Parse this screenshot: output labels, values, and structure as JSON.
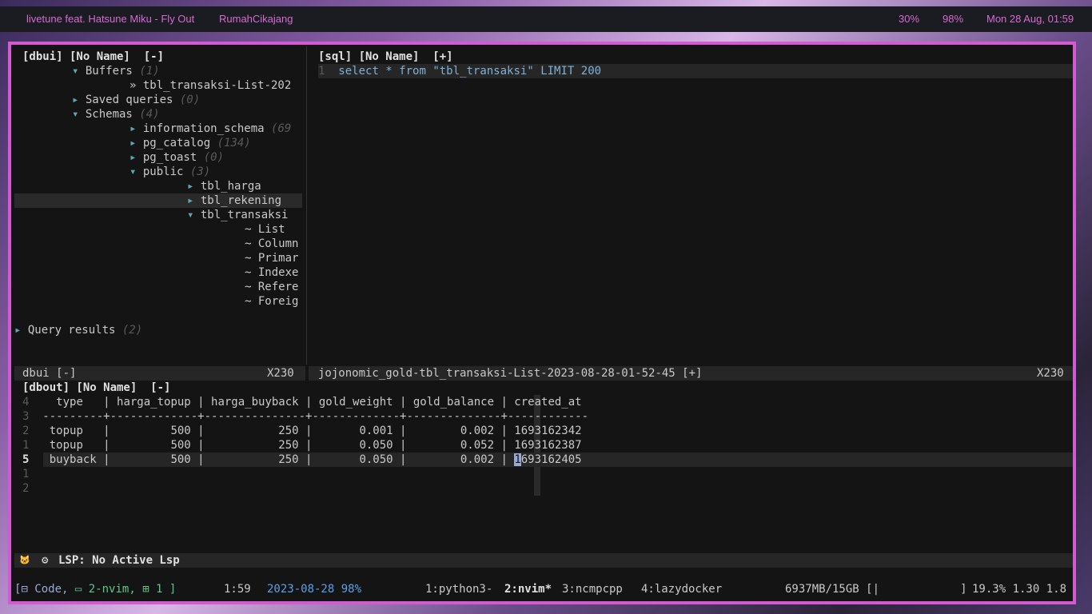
{
  "topbar": {
    "song": "livetune feat. Hatsune Miku - Fly Out",
    "location": "RumahCikajang",
    "battery": "30%",
    "volume": "98%",
    "datetime": "Mon 28 Aug, 01:59"
  },
  "dbui": {
    "header": "[dbui] [No Name]  [-]",
    "tree": [
      {
        "indent": 8,
        "arrow": "▾",
        "label": "Buffers",
        "count": "(1)"
      },
      {
        "indent": 16,
        "arrow": "»",
        "label": "tbl_transaksi-List-202",
        "count": ""
      },
      {
        "indent": 8,
        "arrow": "▸",
        "label": "Saved queries",
        "count": "(0)"
      },
      {
        "indent": 8,
        "arrow": "▾",
        "label": "Schemas",
        "count": "(4)"
      },
      {
        "indent": 16,
        "arrow": "▸",
        "label": "information_schema",
        "count": "(69"
      },
      {
        "indent": 16,
        "arrow": "▸",
        "label": "pg_catalog",
        "count": "(134)"
      },
      {
        "indent": 16,
        "arrow": "▸",
        "label": "pg_toast",
        "count": "(0)"
      },
      {
        "indent": 16,
        "arrow": "▾",
        "label": "public",
        "count": "(3)"
      },
      {
        "indent": 24,
        "arrow": "▸",
        "label": "tbl_harga",
        "count": ""
      },
      {
        "indent": 24,
        "arrow": "▸",
        "label": "tbl_rekening",
        "count": ""
      },
      {
        "indent": 24,
        "arrow": "▾",
        "label": "tbl_transaksi",
        "count": ""
      },
      {
        "indent": 32,
        "arrow": "~",
        "label": "List",
        "count": ""
      },
      {
        "indent": 32,
        "arrow": "~",
        "label": "Column",
        "count": ""
      },
      {
        "indent": 32,
        "arrow": "~",
        "label": "Primar",
        "count": ""
      },
      {
        "indent": 32,
        "arrow": "~",
        "label": "Indexe",
        "count": ""
      },
      {
        "indent": 32,
        "arrow": "~",
        "label": "Refere",
        "count": ""
      },
      {
        "indent": 32,
        "arrow": "~",
        "label": "Foreig",
        "count": ""
      }
    ],
    "query_results_label": "Query results",
    "query_results_count": "(2)",
    "status_left": "dbui [-]",
    "status_right": "X230"
  },
  "sql": {
    "header": "[sql] [No Name]  [+]",
    "line_no": "1",
    "kw_select": "select",
    "star": " * ",
    "kw_from": "from",
    "table": " \"tbl_transaksi\" ",
    "kw_limit": "LIMIT",
    "limit_val": " 200",
    "status_left": "jojonomic_gold-tbl_transaksi-List-2023-08-28-01-52-45 [+]",
    "status_right": "X230"
  },
  "dbout": {
    "header": "[dbout] [No Name]  [-]",
    "rows": [
      {
        "nr": "4",
        "text": "  type   | harga_topup | harga_buyback | gold_weight | gold_balance | created_at"
      },
      {
        "nr": "3",
        "text": "---------+-------------+---------------+-------------+--------------+------------"
      },
      {
        "nr": "2",
        "text": " topup   |         500 |           250 |       0.001 |        0.002 | 1693162342"
      },
      {
        "nr": "1",
        "text": " topup   |         500 |           250 |       0.050 |        0.052 | 1693162387"
      }
    ],
    "current_nr": "5",
    "current_pre": " buyback |         500 |           250 |       0.050 |        0.002 | ",
    "current_cursor": "1",
    "current_post": "693162405",
    "after_rows": [
      "1",
      "2"
    ]
  },
  "lsp": {
    "cat_icon": "🐱",
    "gear_icon": "⚙",
    "label": "LSP: No Active Lsp"
  },
  "tmux": {
    "left": "[",
    "session_icon": "⊟",
    "session": " Code, ",
    "window_icon": "▭",
    "window": " 2-nvim, ",
    "pane_icon": "⊞",
    "pane": " 1 ]",
    "time": "1:59",
    "date_bat": "2023-08-28 98%",
    "win1": "1:python3-",
    "win2": "2:nvim*",
    "win3": "3:ncmpcpp",
    "win4": "4:lazydocker",
    "mem": "6937MB/15GB [|            ]",
    "load": "19.3% 1.30 1.8"
  }
}
